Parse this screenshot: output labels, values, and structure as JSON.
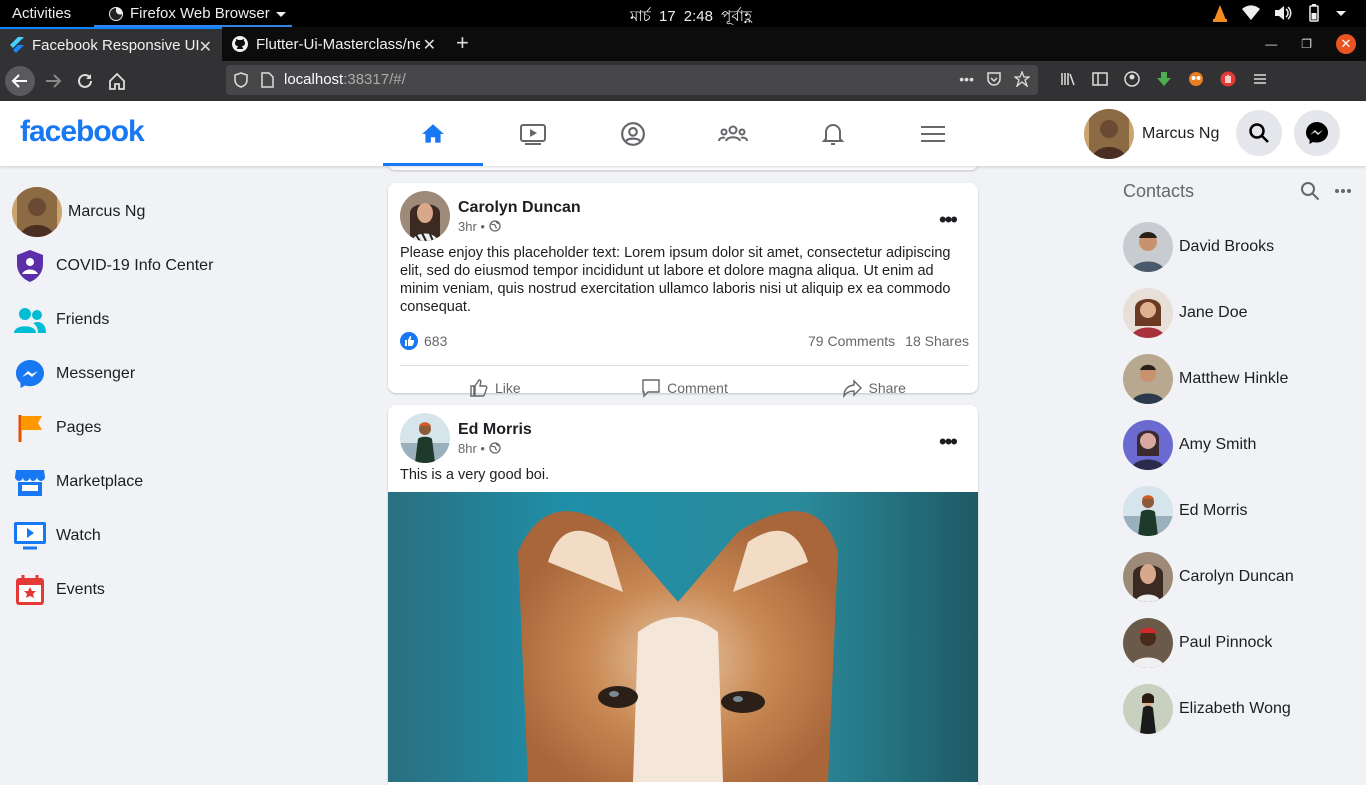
{
  "system_bar": {
    "activities": "Activities",
    "app_name": "Firefox Web Browser",
    "clock": "মার্চ 17  2:48 পূর্বাহ্ণ"
  },
  "browser": {
    "tabs": [
      {
        "title": "Facebook Responsive UI",
        "active": true
      },
      {
        "title": "Flutter-Ui-Masterclass/ne",
        "active": false
      }
    ],
    "url_host": "localhost",
    "url_rest": ":38317/#/"
  },
  "header": {
    "logo": "facebook",
    "user_name": "Marcus Ng"
  },
  "left_nav": {
    "user_name": "Marcus Ng",
    "items": [
      {
        "label": "COVID-19 Info Center"
      },
      {
        "label": "Friends"
      },
      {
        "label": "Messenger"
      },
      {
        "label": "Pages"
      },
      {
        "label": "Marketplace"
      },
      {
        "label": "Watch"
      },
      {
        "label": "Events"
      }
    ]
  },
  "posts": [
    {
      "author": "Carolyn Duncan",
      "time": "3hr •",
      "text": "Please enjoy this placeholder text: Lorem ipsum dolor sit amet, consectetur adipiscing elit, sed do eiusmod tempor incididunt ut labore et dolore magna aliqua. Ut enim ad minim veniam, quis nostrud exercitation ullamco laboris nisi ut aliquip ex ea commodo consequat.",
      "likes": "683",
      "comments": "79 Comments",
      "shares": "18 Shares",
      "actions": {
        "like": "Like",
        "comment": "Comment",
        "share": "Share"
      }
    },
    {
      "author": "Ed Morris",
      "time": "8hr •",
      "text": "This is a very good boi."
    }
  ],
  "contacts": {
    "title": "Contacts",
    "list": [
      {
        "name": "David Brooks",
        "color": "#4a5a6a"
      },
      {
        "name": "Jane Doe",
        "color": "#a8323c"
      },
      {
        "name": "Matthew Hinkle",
        "color": "#6b5a4a"
      },
      {
        "name": "Amy Smith",
        "color": "#5a5ab0"
      },
      {
        "name": "Ed Morris",
        "color": "#2f4a3a"
      },
      {
        "name": "Carolyn Duncan",
        "color": "#7a5a48"
      },
      {
        "name": "Paul Pinnock",
        "color": "#b03a2e"
      },
      {
        "name": "Elizabeth Wong",
        "color": "#5a6a5a"
      }
    ]
  },
  "colors": {
    "brand": "#1877f2",
    "background": "#f0f2f5",
    "text_secondary": "#65676b"
  }
}
